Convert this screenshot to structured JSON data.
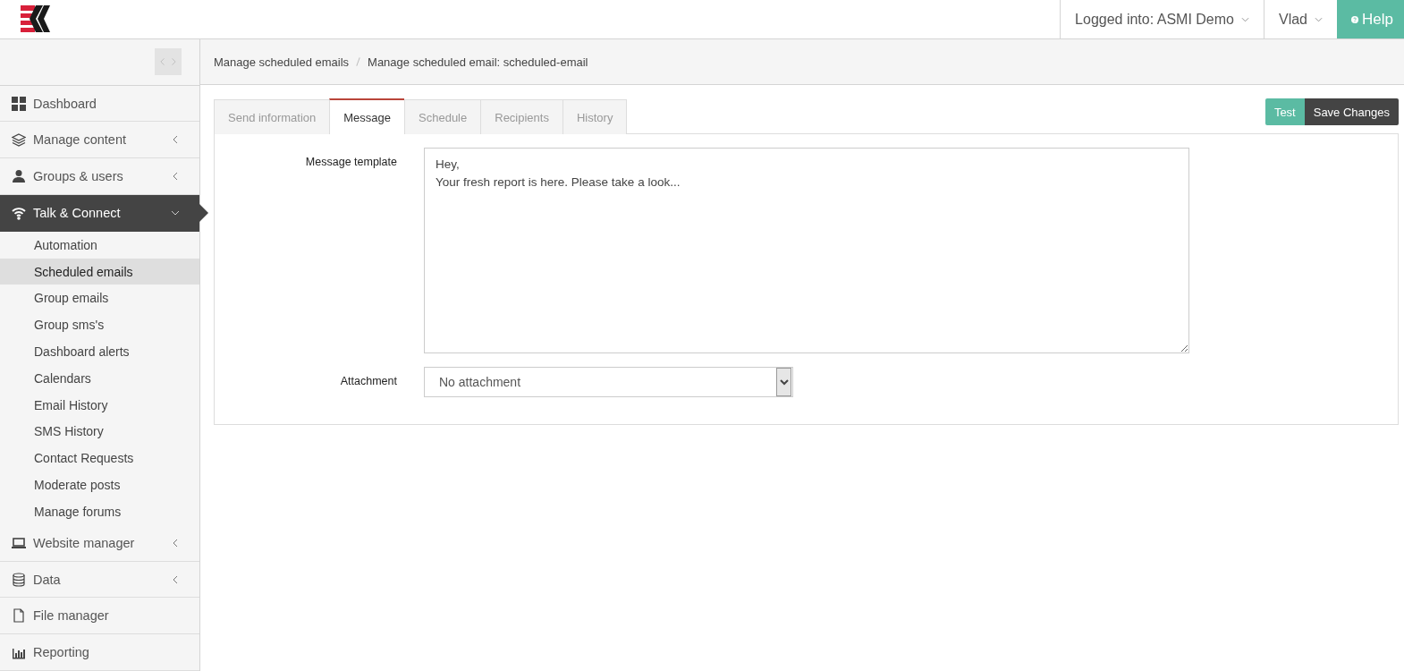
{
  "header": {
    "account": "Logged into: ASMI Demo",
    "user": "Vlad",
    "help": "Help"
  },
  "breadcrumb": [
    "Manage scheduled emails",
    "Manage scheduled email: scheduled-email"
  ],
  "sidebar": {
    "items": [
      {
        "label": "Dashboard",
        "selected": false
      },
      {
        "label": "Manage content",
        "expanded": false,
        "selected": false
      },
      {
        "label": "Groups & users",
        "expanded": false,
        "selected": false
      },
      {
        "label": "Talk & Connect",
        "expanded": true,
        "selected": true,
        "children": [
          {
            "label": "Automation",
            "selected": false
          },
          {
            "label": "Scheduled emails",
            "selected": true
          },
          {
            "label": "Group emails",
            "selected": false
          },
          {
            "label": "Group sms's",
            "selected": false
          },
          {
            "label": "Dashboard alerts",
            "selected": false
          },
          {
            "label": "Calendars",
            "selected": false
          },
          {
            "label": "Email History",
            "selected": false
          },
          {
            "label": "SMS History",
            "selected": false
          },
          {
            "label": "Contact Requests",
            "selected": false
          },
          {
            "label": "Moderate posts",
            "selected": false
          },
          {
            "label": "Manage forums",
            "selected": false
          }
        ]
      },
      {
        "label": "Website manager",
        "expanded": false,
        "selected": false
      },
      {
        "label": "Data",
        "expanded": false,
        "selected": false
      },
      {
        "label": "File manager",
        "selected": false
      },
      {
        "label": "Reporting",
        "selected": false
      }
    ]
  },
  "tabs": [
    {
      "label": "Send information",
      "selected": false
    },
    {
      "label": "Message",
      "selected": true
    },
    {
      "label": "Schedule",
      "selected": false
    },
    {
      "label": "Recipients",
      "selected": false
    },
    {
      "label": "History",
      "selected": false
    }
  ],
  "actions": {
    "test": "Test",
    "save": "Save Changes"
  },
  "form": {
    "template_label": "Message template",
    "template_value": "Hey,\nYour fresh report is here. Please take a look...",
    "attachment_label": "Attachment",
    "attachment_value": "No attachment"
  }
}
